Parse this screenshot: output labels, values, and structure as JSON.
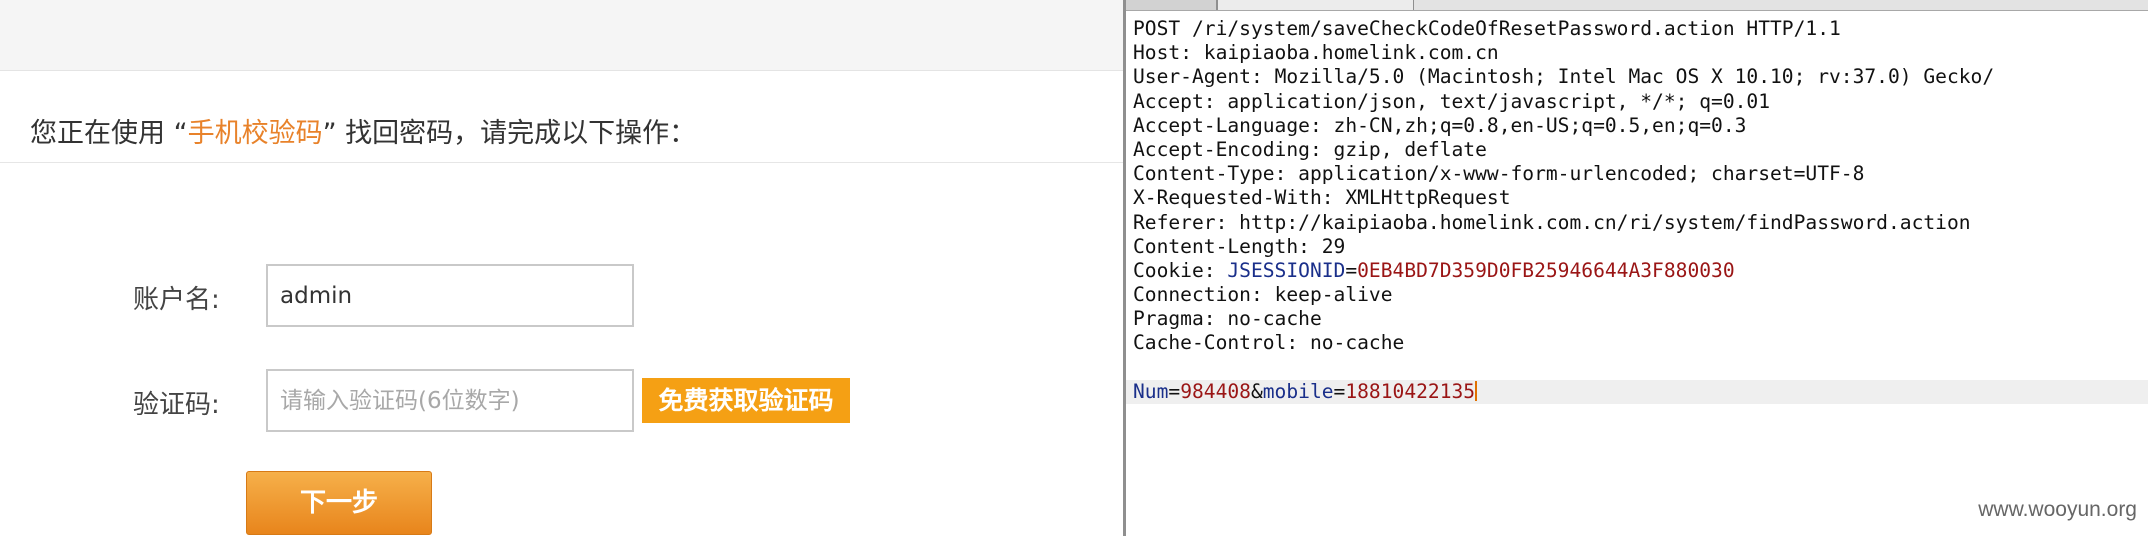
{
  "web_form": {
    "instruction": {
      "prefix": "您正在使用 “",
      "method": "手机校验码",
      "suffix": "” 找回密码，请完成以下操作："
    },
    "account_label": "账户名:",
    "account_value": "admin",
    "code_label": "验证码:",
    "code_placeholder": "请输入验证码(6位数字)",
    "get_code_button": "免费获取验证码",
    "next_button": "下一步"
  },
  "http_request": {
    "request_line": "POST /ri/system/saveCheckCodeOfResetPassword.action HTTP/1.1",
    "headers": [
      {
        "name": "Host",
        "value": "kaipiaoba.homelink.com.cn"
      },
      {
        "name": "User-Agent",
        "value": "Mozilla/5.0 (Macintosh; Intel Mac OS X 10.10; rv:37.0) Gecko/"
      },
      {
        "name": "Accept",
        "value": "application/json, text/javascript, */*; q=0.01"
      },
      {
        "name": "Accept-Language",
        "value": "zh-CN,zh;q=0.8,en-US;q=0.5,en;q=0.3"
      },
      {
        "name": "Accept-Encoding",
        "value": "gzip, deflate"
      },
      {
        "name": "Content-Type",
        "value": "application/x-www-form-urlencoded; charset=UTF-8"
      },
      {
        "name": "X-Requested-With",
        "value": "XMLHttpRequest"
      },
      {
        "name": "Referer",
        "value": "http://kaipiaoba.homelink.com.cn/ri/system/findPassword.action"
      },
      {
        "name": "Content-Length",
        "value": "29"
      }
    ],
    "cookie": {
      "label": "Cookie: ",
      "name": "JSESSIONID",
      "value": "0EB4BD7D359D0FB25946644A3F880030"
    },
    "headers_after": [
      {
        "name": "Connection",
        "value": "keep-alive"
      },
      {
        "name": "Pragma",
        "value": "no-cache"
      },
      {
        "name": "Cache-Control",
        "value": "no-cache"
      }
    ],
    "body_params": [
      {
        "name": "Num",
        "value": "984408"
      },
      {
        "name": "mobile",
        "value": "18810422135"
      }
    ]
  },
  "watermark": "www.wooyun.org",
  "colors": {
    "accent_orange": "#e8822a",
    "button_orange": "#f5a014",
    "param_name_blue": "#1a2f8a",
    "param_value_red": "#9a1515"
  }
}
